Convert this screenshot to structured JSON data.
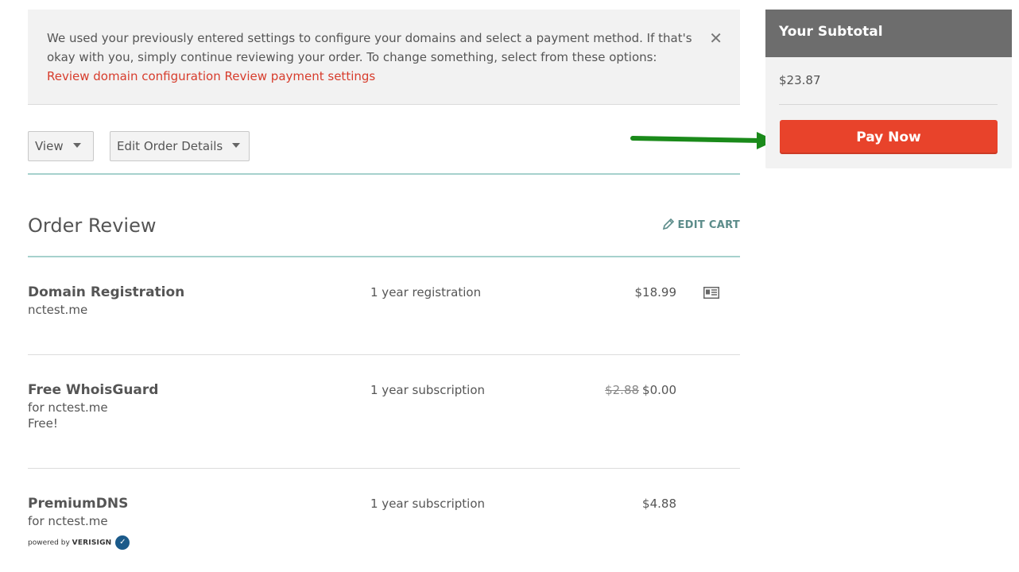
{
  "notice": {
    "text": "We used your previously entered settings to configure your domains and select a payment method. If that's okay with you, simply continue reviewing your order. To change something, select from these options:",
    "link_domain": "Review domain configuration",
    "link_payment": "Review payment settings",
    "close_glyph": "✕"
  },
  "toolbar": {
    "view_label": "View",
    "edit_label": "Edit Order Details"
  },
  "review": {
    "title": "Order Review",
    "edit_cart": "EDIT CART"
  },
  "items": [
    {
      "name": "Domain Registration",
      "sub1": "nctest.me",
      "term": "1 year registration",
      "price": "$18.99",
      "icon": "contact-card-icon"
    },
    {
      "name": "Free WhoisGuard",
      "sub1": "for nctest.me",
      "sub2": "Free!",
      "term": "1 year subscription",
      "old_price": "$2.88",
      "price": "$0.00"
    },
    {
      "name": "PremiumDNS",
      "sub1": "for nctest.me",
      "term": "1 year subscription",
      "price": "$4.88",
      "powered_prefix": "powered by",
      "powered_brand": "VERISIGN"
    }
  ],
  "sidebar": {
    "title": "Your Subtotal",
    "subtotal": "$23.87",
    "pay_label": "Pay Now"
  },
  "colors": {
    "accent_red": "#e8432b",
    "link_red": "#d73c2c",
    "teal_rule": "#a6d1cd",
    "arrow_green": "#1a8a1a"
  }
}
